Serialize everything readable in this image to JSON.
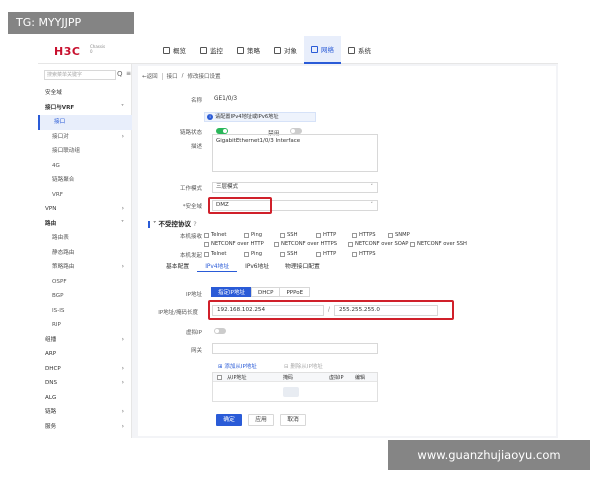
{
  "watermark_top": "TG: MYYJJPP",
  "watermark_bottom": "www.guanzhujiaoyu.com",
  "brand": {
    "logo": "H3C",
    "sub_line1": "Chassis",
    "sub_line2": "0"
  },
  "nav": [
    {
      "label": "概览",
      "icon": "dashboard-icon"
    },
    {
      "label": "监控",
      "icon": "monitor-icon"
    },
    {
      "label": "策略",
      "icon": "policy-icon"
    },
    {
      "label": "对象",
      "icon": "object-icon"
    },
    {
      "label": "网络",
      "icon": "network-icon",
      "active": true
    },
    {
      "label": "系统",
      "icon": "system-icon"
    }
  ],
  "sidebar": {
    "search_placeholder": "搜索菜单关键字",
    "search_icon": "Q",
    "collapse_icon": "≡",
    "items": [
      {
        "label": "安全域",
        "level": 0
      },
      {
        "label": "接口与VRF",
        "level": 0,
        "bold": true,
        "arrow": "˅"
      },
      {
        "label": "接口",
        "level": 1,
        "active": true
      },
      {
        "label": "接口对",
        "level": 1,
        "arrow": "›"
      },
      {
        "label": "接口联动组",
        "level": 1
      },
      {
        "label": "4G",
        "level": 1
      },
      {
        "label": "链路聚合",
        "level": 1
      },
      {
        "label": "VRF",
        "level": 1
      },
      {
        "label": "VPN",
        "level": 0,
        "arrow": "›"
      },
      {
        "label": "路由",
        "level": 0,
        "bold": true,
        "arrow": "˅"
      },
      {
        "label": "路由表",
        "level": 1
      },
      {
        "label": "静态路由",
        "level": 1
      },
      {
        "label": "策略路由",
        "level": 1,
        "arrow": "›"
      },
      {
        "label": "OSPF",
        "level": 1
      },
      {
        "label": "BGP",
        "level": 1
      },
      {
        "label": "IS-IS",
        "level": 1
      },
      {
        "label": "RIP",
        "level": 1
      },
      {
        "label": "组播",
        "level": 0,
        "arrow": "›"
      },
      {
        "label": "ARP",
        "level": 0
      },
      {
        "label": "DHCP",
        "level": 0,
        "arrow": "›"
      },
      {
        "label": "DNS",
        "level": 0,
        "arrow": "›"
      },
      {
        "label": "ALG",
        "level": 0
      },
      {
        "label": "链路",
        "level": 0,
        "arrow": "›"
      },
      {
        "label": "服务",
        "level": 0,
        "arrow": "›"
      }
    ]
  },
  "breadcrumb": {
    "back": "←返回",
    "level1": "接口",
    "sep": "/",
    "level2": "修改接口设置"
  },
  "form": {
    "name_label": "名称",
    "name_value": "GE1/0/3",
    "info_text": "请配置IPv4地址或IPv6地址",
    "info_icon": "i",
    "link_state_label": "链路状态",
    "enable_label": "禁用",
    "desc_label": "描述",
    "desc_value": "GigabitEthernet1/0/3 Interface",
    "mode_label": "工作模式",
    "mode_value": "三层模式",
    "zone_label": "*安全域",
    "zone_value": "DMZ",
    "dd_icon": "˅"
  },
  "access": {
    "title": "不受控协议",
    "caret": "˅",
    "help_icon": "?",
    "local_label": "本机接收",
    "forward_label": "本机发起",
    "local_opts": [
      "Telnet",
      "Ping",
      "SSH",
      "HTTP",
      "HTTPS",
      "SNMP"
    ],
    "local_opts2": [
      "NETCONF over HTTP",
      "NETCONF over HTTPS",
      "NETCONF over SOAP",
      "NETCONF over SSH"
    ],
    "forward_opts": [
      "Telnet",
      "Ping",
      "SSH",
      "HTTP",
      "HTTPS"
    ]
  },
  "tabs": [
    "基本配置",
    "IPv4地址",
    "IPv6地址",
    "物理接口配置"
  ],
  "ipv4": {
    "ip_label": "IP地址",
    "modes": [
      "指定IP地址",
      "DHCP",
      "PPPoE"
    ],
    "addr_label": "IP地址/掩码长度",
    "ip_value": "192.168.102.254",
    "slash": "/",
    "mask_value": "255.255.255.0",
    "virtual_ip_label": "虚拟IP",
    "gateway_label": "网关",
    "add_secondary": "添加从IP地址",
    "delete_secondary": "删除从IP地址",
    "add_icon": "⊞",
    "delete_icon": "⊟",
    "table_headers": [
      "从IP地址",
      "掩码",
      "虚拟IP",
      "编辑"
    ]
  },
  "buttons": {
    "ok": "确定",
    "apply": "应用",
    "cancel": "取消"
  }
}
